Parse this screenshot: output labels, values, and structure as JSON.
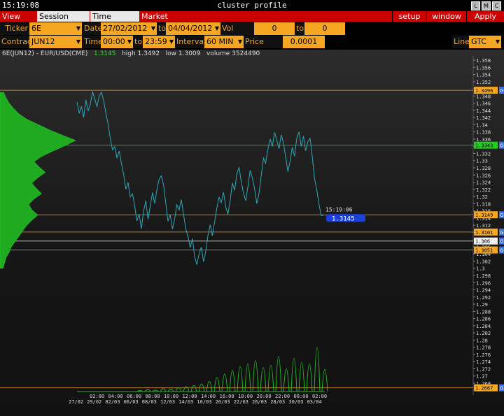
{
  "window": {
    "clock": "15:19:08",
    "title": "cluster profile",
    "buttons": [
      "L",
      "M",
      "C"
    ]
  },
  "menu": {
    "left": [
      "View DOM",
      "Session Hours",
      "Time Interval",
      "Market Watch"
    ],
    "right": [
      "setup",
      "window",
      "Apply"
    ]
  },
  "controls": {
    "ticker_label": "Ticker",
    "ticker": "6E",
    "date_label": "Date",
    "date_from": "27/02/2012",
    "to1": "to",
    "date_to": "04/04/2012",
    "volrange_label": "Vol range",
    "vol_from": "0",
    "to2": "to",
    "vol_to": "0",
    "contract_label": "Contract",
    "contract": "JUN12",
    "time_label": "Time",
    "time_from": "00:00",
    "to3": "to",
    "time_to": "23:59",
    "interval_label": "Interval",
    "interval": "60 MIN",
    "pricescale_label": "Price Scale",
    "pricescale": "0.0001",
    "line_label": "Line",
    "line": "GTC"
  },
  "info": {
    "symbol": "6E(JUN12) - EUR/USD(CME)",
    "last": "1.3145",
    "high": "high 1.3492",
    "low": "low 1.3009",
    "volume": "volume 3524490"
  },
  "chart_data": {
    "type": "line",
    "y_tick_labels": [
      "1.358",
      "1.356",
      "1.354",
      "1.352",
      "1.35",
      "1.348",
      "1.346",
      "1.344",
      "1.342",
      "1.34",
      "1.338",
      "1.336",
      "1.334",
      "1.332",
      "1.33",
      "1.328",
      "1.326",
      "1.324",
      "1.322",
      "1.32",
      "1.318",
      "1.316",
      "1.314",
      "1.312",
      "1.31",
      "1.308",
      "1.306",
      "1.304",
      "1.302",
      "1.3",
      "1.298",
      "1.296",
      "1.294",
      "1.292",
      "1.29",
      "1.288",
      "1.286",
      "1.284",
      "1.282",
      "1.28",
      "1.278",
      "1.276",
      "1.274",
      "1.272",
      "1.27",
      "1.268"
    ],
    "x_time_labels": [
      "02:00",
      "04:00",
      "06:00",
      "08:00",
      "10:00",
      "12:00",
      "14:00",
      "16:00",
      "18:00",
      "20:00",
      "22:00",
      "00:00",
      "02:00"
    ],
    "x_date_labels": [
      "27/02",
      "29/02",
      "02/03",
      "06/03",
      "08/03",
      "12/03",
      "14/03",
      "16/03",
      "20/03",
      "22/03",
      "26/03",
      "28/03",
      "30/03",
      "03/04"
    ],
    "level_lines": [
      {
        "price": 1.3496,
        "label": "1.3496",
        "color": "#d98a2a",
        "badge": "#f5a623"
      },
      {
        "price": 1.3343,
        "label": "1.3343",
        "color": "#2fb52f",
        "badge": "#22cc22"
      },
      {
        "price": 1.3149,
        "label": "1.3149",
        "color": "#d98a2a",
        "badge": "#f5a623"
      },
      {
        "price": 1.3101,
        "label": "1.3101",
        "color": "#d98a2a",
        "badge": "#f5a623"
      },
      {
        "price": 1.3076,
        "label": "1.306",
        "color": "#dddddd",
        "badge": "#eeeeee"
      },
      {
        "price": 1.3051,
        "label": "1.3051",
        "color": "#d98a2a",
        "badge": "#f5a623"
      },
      {
        "price": 1.2667,
        "label": "1.2667",
        "color": "#d98a2a",
        "badge": "#f5a623"
      }
    ],
    "current_time": "15:19:06",
    "current_price": "1.3145",
    "price_series": [
      1.346,
      1.343,
      1.345,
      1.342,
      1.347,
      1.344,
      1.346,
      1.349,
      1.347,
      1.345,
      1.348,
      1.3492,
      1.347,
      1.343,
      1.34,
      1.336,
      1.333,
      1.334,
      1.331,
      1.333,
      1.329,
      1.326,
      1.322,
      1.324,
      1.32,
      1.321,
      1.317,
      1.313,
      1.315,
      1.311,
      1.316,
      1.319,
      1.314,
      1.317,
      1.321,
      1.318,
      1.322,
      1.325,
      1.326,
      1.323,
      1.318,
      1.313,
      1.315,
      1.311,
      1.314,
      1.318,
      1.316,
      1.319,
      1.315,
      1.311,
      1.309,
      1.306,
      1.308,
      1.303,
      1.3009,
      1.304,
      1.306,
      1.302,
      1.305,
      1.309,
      1.312,
      1.309,
      1.313,
      1.317,
      1.32,
      1.318,
      1.321,
      1.317,
      1.315,
      1.319,
      1.324,
      1.322,
      1.326,
      1.328,
      1.324,
      1.321,
      1.319,
      1.323,
      1.327,
      1.325,
      1.322,
      1.318,
      1.321,
      1.326,
      1.331,
      1.329,
      1.333,
      1.336,
      1.334,
      1.338,
      1.336,
      1.333,
      1.337,
      1.335,
      1.331,
      1.327,
      1.33,
      1.334,
      1.331,
      1.336,
      1.338,
      1.334,
      1.337,
      1.333,
      1.335,
      1.336,
      1.331,
      1.325,
      1.322,
      1.318,
      1.315,
      1.3145
    ],
    "volume_series": [
      0,
      0,
      0,
      0,
      0,
      0,
      0,
      0,
      0,
      0,
      0,
      0,
      0,
      0,
      0,
      0,
      0,
      0,
      0,
      0,
      0,
      0,
      0,
      0,
      0,
      0,
      0,
      0,
      0,
      0,
      0,
      0,
      0,
      0,
      0,
      0,
      0,
      0,
      0,
      0,
      0,
      0,
      0,
      0,
      0,
      0,
      0,
      0,
      0,
      0,
      0,
      0,
      0,
      0,
      0,
      0,
      0,
      0,
      0,
      0,
      0,
      0,
      0,
      0,
      0,
      0,
      0,
      0,
      0,
      0,
      0,
      0,
      0,
      0,
      0,
      0,
      0,
      0,
      0,
      0,
      0,
      0,
      0,
      0,
      0,
      0,
      0,
      0,
      0,
      0,
      0,
      0,
      0,
      0,
      0,
      0,
      0,
      0,
      0,
      0,
      0,
      0,
      0,
      0,
      0,
      0,
      0,
      0,
      0,
      0,
      0,
      0
    ],
    "volume_spikes": [
      0.02,
      0.04,
      0.03,
      0.06,
      0.05,
      0.08,
      0.1,
      0.12,
      0.15,
      0.2,
      0.28,
      0.35,
      0.42,
      0.5,
      0.55,
      0.62,
      0.48,
      0.52,
      0.7,
      0.45,
      0.66,
      0.58,
      0.55,
      0.88,
      0.44
    ],
    "profile": [
      0.05,
      0.08,
      0.12,
      0.18,
      0.25,
      0.35,
      0.5,
      0.65,
      0.82,
      1.0,
      0.86,
      0.7,
      0.55,
      0.45,
      0.52,
      0.6,
      0.5,
      0.42,
      0.48,
      0.55,
      0.45,
      0.38,
      0.42,
      0.5,
      0.42,
      0.35,
      0.3,
      0.25,
      0.2,
      0.15,
      0.12,
      0.08,
      0.06,
      0.04
    ]
  }
}
